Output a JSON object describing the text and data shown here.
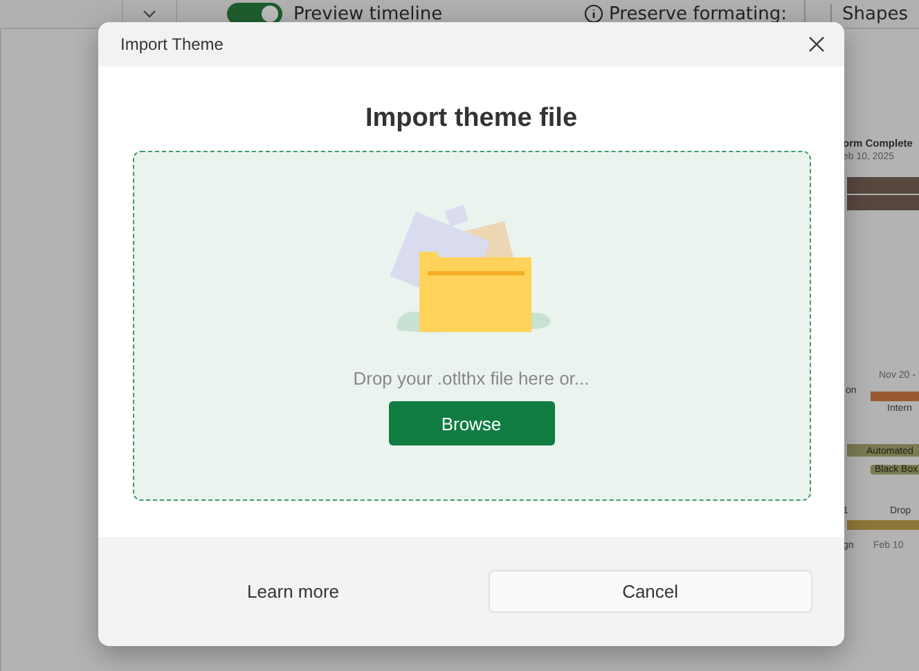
{
  "toolbar": {
    "toggle": {
      "label": "Preview timeline",
      "on": true
    },
    "preserve_label": "Preserve formating:",
    "shapes_tab": "Shapes"
  },
  "timeline": [
    {
      "text": "orm Complete",
      "kind": "title"
    },
    {
      "text": "eb 10, 2025",
      "kind": "date"
    },
    {
      "text": "Nov 20 -",
      "kind": "date"
    },
    {
      "text": "on",
      "kind": "label"
    },
    {
      "text": "Intern",
      "kind": "label"
    },
    {
      "text": "Automated",
      "kind": "tag"
    },
    {
      "text": "Black Box",
      "kind": "tag"
    },
    {
      "text": "1",
      "kind": "label"
    },
    {
      "text": "Drop",
      "kind": "label"
    },
    {
      "text": "gn",
      "kind": "label"
    },
    {
      "text": "Feb 10",
      "kind": "date"
    }
  ],
  "dialog": {
    "title": "Import Theme",
    "heading": "Import theme file",
    "drop_hint": "Drop your .otlthx file here or...",
    "browse": "Browse",
    "learn_more": "Learn more",
    "cancel": "Cancel"
  }
}
